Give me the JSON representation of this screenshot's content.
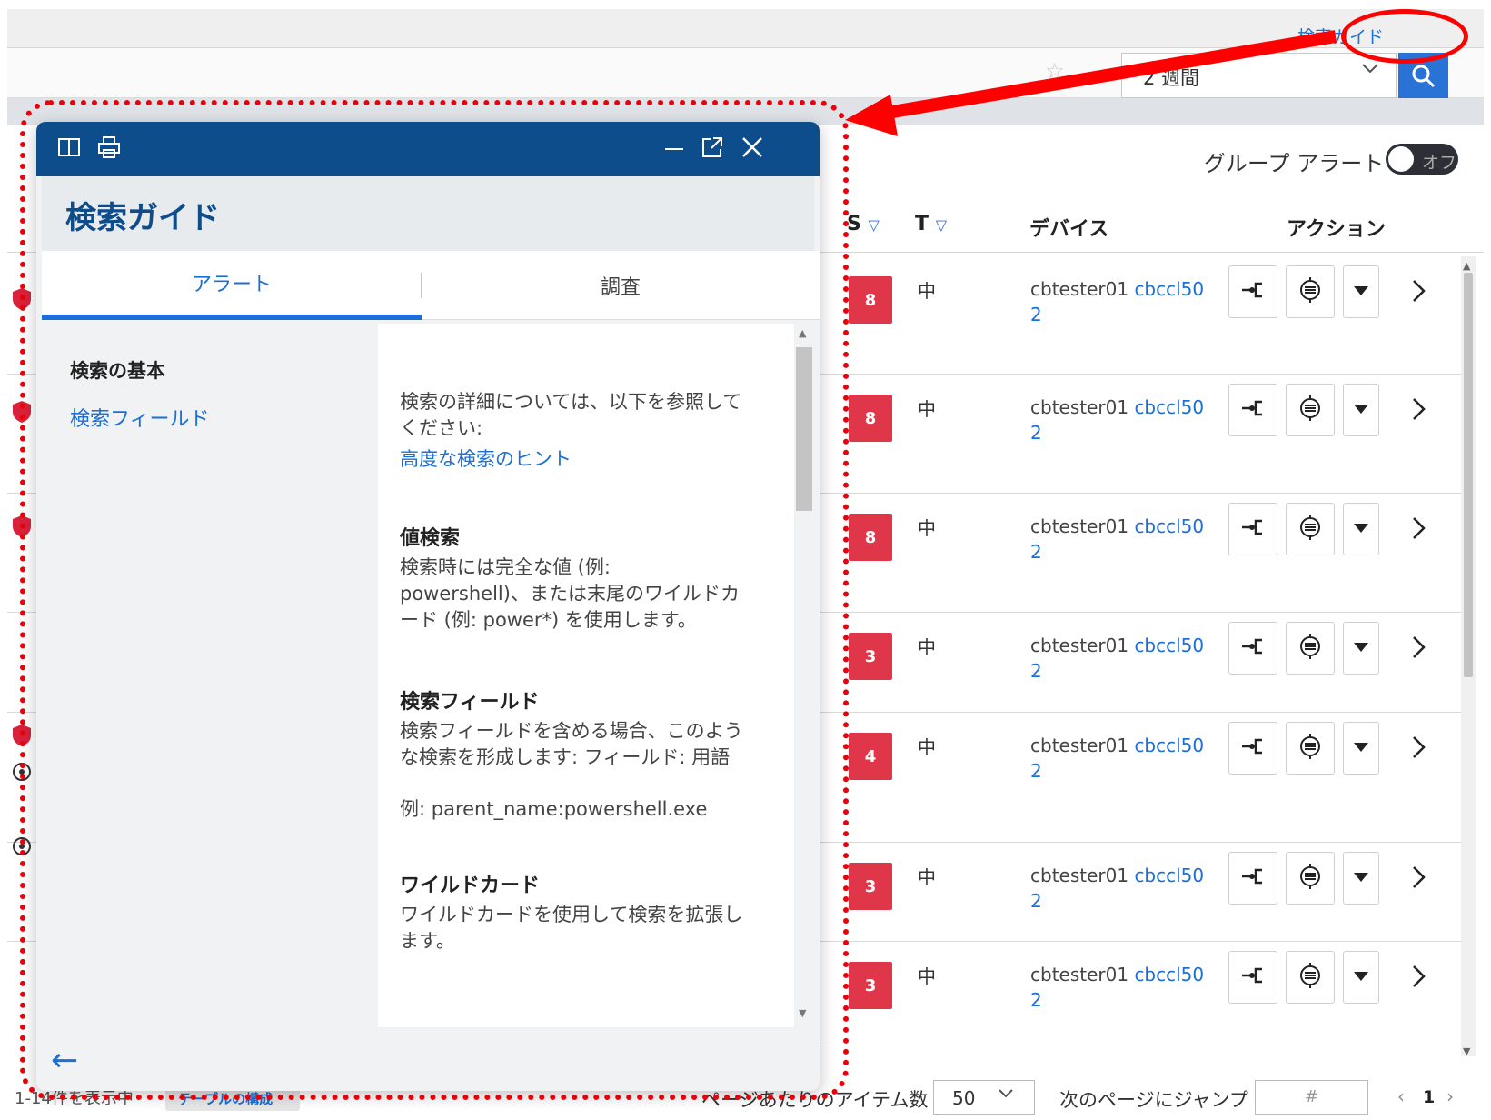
{
  "topbar": {
    "search_guide_link": "検索ガイド"
  },
  "search_row": {
    "time_range": "2 週間"
  },
  "toolbar": {
    "group_alert_label": "グループ アラート",
    "group_alert_toggle": "オフ"
  },
  "table": {
    "headers": {
      "s": "S",
      "t": "T",
      "device": "デバイス",
      "action": "アクション"
    },
    "rows": [
      {
        "severity": "8",
        "t": "中",
        "device_host": "cbtester01",
        "device_link": "cbccl50",
        "device_link_2": "2"
      },
      {
        "severity": "8",
        "t": "中",
        "device_host": "cbtester01",
        "device_link": "cbccl50",
        "device_link_2": "2"
      },
      {
        "severity": "8",
        "t": "中",
        "device_host": "cbtester01",
        "device_link": "cbccl50",
        "device_link_2": "2"
      },
      {
        "severity": "3",
        "t": "中",
        "device_host": "cbtester01",
        "device_link": "cbccl50",
        "device_link_2": "2"
      },
      {
        "severity": "4",
        "t": "中",
        "device_host": "cbtester01",
        "device_link": "cbccl50",
        "device_link_2": "2"
      },
      {
        "severity": "3",
        "t": "中",
        "device_host": "cbtester01",
        "device_link": "cbccl50",
        "device_link_2": "2"
      },
      {
        "severity": "3",
        "t": "中",
        "device_host": "cbtester01",
        "device_link": "cbccl50",
        "device_link_2": "2"
      }
    ]
  },
  "footer": {
    "count_text": "1-14件を表示中",
    "table_config": "テーブルの構成",
    "per_page_label": "ページあたりのアイテム数",
    "per_page_value": "50",
    "jump_label": "次のページにジャンプ",
    "jump_placeholder": "#",
    "current_page": "1"
  },
  "guide": {
    "title": "検索ガイド",
    "tabs": [
      "アラート",
      "調査"
    ],
    "nav": {
      "basics": "検索の基本",
      "fields": "検索フィールド"
    },
    "content": {
      "intro": "検索の詳細については、以下を参照してください:",
      "intro_link": "高度な検索のヒント",
      "value_search_heading": "値検索",
      "value_search_text": "検索時には完全な値 (例: powershell)、または末尾のワイルドカード (例: power*) を使用します。",
      "field_search_heading": "検索フィールド",
      "field_search_text": "検索フィールドを含める場合、このような検索を形成します: フィールド: 用語",
      "field_search_example": "例: parent_name:powershell.exe",
      "wildcard_heading": "ワイルドカード",
      "wildcard_text": "ワイルドカードを使用して検索を拡張します。"
    }
  },
  "colors": {
    "accent": "#1b6fd6",
    "header": "#0e4d8c",
    "severity": "#e0364a",
    "annotation": "#ff0000"
  }
}
